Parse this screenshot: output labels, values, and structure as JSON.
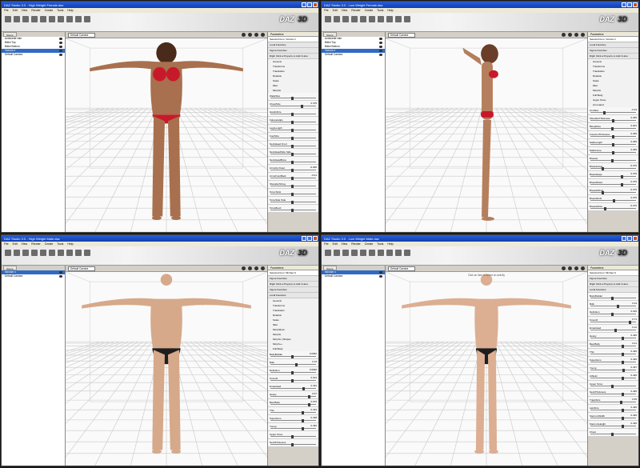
{
  "windows": [
    {
      "title": "DAZ Studio 3.0 - High Weight Female.daz",
      "menu": [
        "File",
        "Edit",
        "View",
        "Render",
        "Create",
        "Tools",
        "Help"
      ],
      "scene_tab": "Scene",
      "scene_items": [
        "Antoinette Hair",
        "Bikini Top",
        "Bikini Bottom",
        "Victoria 4",
        "Default Camera"
      ],
      "selected_scene_index": 3,
      "camera": "Default Camera",
      "params_tab": "Parameters",
      "selected_item_label": "Selected Item:",
      "selected_item": "Victoria 4",
      "groups_top": [
        "Local Favorites",
        "Figure Favorites",
        "Right Click a Property to Add it Here"
      ],
      "tree": [
        "General",
        "Transforms",
        "Translation",
        "Rotation",
        "Scale",
        "Misc",
        "Morphs"
      ],
      "sliders": [
        {
          "label": "WaistSize",
          "value": ""
        },
        {
          "label": "ChestSize",
          "value": "0.375"
        },
        {
          "label": "HandsSize",
          "value": ""
        },
        {
          "label": "FatnessHips",
          "value": ""
        },
        {
          "label": "LegsLength",
          "value": ""
        },
        {
          "label": "FootSize",
          "value": ""
        },
        {
          "label": "NeckHead Front",
          "value": ""
        },
        {
          "label": "NeckHeadSide Side",
          "value": ""
        },
        {
          "label": "NeckHeadBone",
          "value": ""
        },
        {
          "label": "ArmsUp Down",
          "value": "-0.000"
        },
        {
          "label": "ArmsFrontBack",
          "value": "-0.01"
        },
        {
          "label": "ShoulderShrug",
          "value": ""
        },
        {
          "label": "TorsoTwist",
          "value": ""
        },
        {
          "label": "TorsoSide Side",
          "value": ""
        },
        {
          "label": "TorsoBend",
          "value": ""
        }
      ]
    },
    {
      "title": "DAZ Studio 3.0 - Low Weight Female.daz",
      "menu": [
        "File",
        "Edit",
        "View",
        "Render",
        "Create",
        "Tools",
        "Help"
      ],
      "scene_tab": "Scene",
      "scene_items": [
        "Antoinette Hair",
        "Bikini Top",
        "Bikini Bottom",
        "Victoria 4",
        "Default Camera"
      ],
      "selected_scene_index": 3,
      "camera": "Default Camera",
      "params_tab": "Parameters",
      "selected_item_label": "Selected Item:",
      "selected_item": "Victoria 4",
      "groups_top": [
        "Local Favorites",
        "Figure Favorites",
        "Right Click a Property to Add it Here"
      ],
      "tree": [
        "General",
        "Transforms",
        "Translation",
        "Rotation",
        "Scale",
        "Misc",
        "Morphs",
        "Full Body",
        "Upper Torso",
        "Arm-Hand"
      ],
      "sliders": [
        {
          "label": "ArmSize",
          "value": "-0.33"
        },
        {
          "label": "ShoulderThickness",
          "value": "0.035"
        },
        {
          "label": "BiceptFlex",
          "value": "0.001"
        },
        {
          "label": "ForeArmThickness",
          "value": "0.035"
        },
        {
          "label": "NailsLength",
          "value": "0.035"
        },
        {
          "label": "NailsCurve",
          "value": "0.035"
        },
        {
          "label": "Breasts",
          "value": ""
        },
        {
          "label": "BreastLarge",
          "value": "-0.376"
        },
        {
          "label": "BreastsAge",
          "value": "0.379"
        },
        {
          "label": "BreastDown",
          "value": "0.370"
        },
        {
          "label": "BreastsShort",
          "value": "-0.376"
        },
        {
          "label": "BreastsFull",
          "value": "0.076"
        },
        {
          "label": "BreastsSize",
          "value": "-0.276"
        }
      ]
    },
    {
      "title": "DAZ Studio 3.0 - High Weight Male.daz",
      "menu": [
        "File",
        "Edit",
        "View",
        "Render",
        "Create",
        "Tools",
        "Help"
      ],
      "scene_tab": "Scene",
      "scene_items": [
        "Michael 4",
        "Default Camera"
      ],
      "selected_scene_index": 0,
      "camera": "Default Camera",
      "params_tab": "Parameters",
      "selected_item_label": "Selected Item:",
      "selected_item": "Michael 4",
      "groups_top": [
        "Figure Favorites",
        "Right Click a Property to Add it Here",
        "Figure Favorites",
        "Local Favorites"
      ],
      "tree": [
        "General",
        "Transforms",
        "Translation",
        "Rotation",
        "Scale",
        "Misc",
        "Morphdesc",
        "Morphs",
        "Morphs | Shapes",
        "Morph++",
        "Full Body"
      ],
      "sliders": [
        {
          "label": "BodyBuilder",
          "value": "0.0052"
        },
        {
          "label": "Bulk",
          "value": "0.16"
        },
        {
          "label": "Definition",
          "value": "0.0000"
        },
        {
          "label": "Smooth",
          "value": "0.014"
        },
        {
          "label": "Emaciated",
          "value": "0.434"
        },
        {
          "label": "Heavy",
          "value": "0.67"
        },
        {
          "label": "BeerBelly",
          "value": "0.676"
        },
        {
          "label": "Thin",
          "value": "0.424"
        },
        {
          "label": "SuperHero",
          "value": "0.428"
        },
        {
          "label": "Young",
          "value": "0.430"
        },
        {
          "label": "Upper Torso",
          "value": ""
        },
        {
          "label": "NeckThickness",
          "value": ""
        }
      ]
    },
    {
      "title": "DAZ Studio 3.0 - Low Weight Male.daz",
      "menu": [
        "File",
        "Edit",
        "View",
        "Render",
        "Create",
        "Tools",
        "Help"
      ],
      "scene_tab": "Scene",
      "scene_items": [
        "Michael 4",
        "Default Camera"
      ],
      "selected_scene_index": 0,
      "camera": "Default Camera",
      "activity_hint": "Click an item to select an activity",
      "activity_tab": "Activity Tabs",
      "params_tab": "Parameters",
      "selected_item_label": "Selected Item:",
      "selected_item": "Michael 4",
      "groups_top": [
        "Figure Favorites",
        "Right Click a Property to Add it Here",
        "Local Favorites"
      ],
      "tree": [],
      "sliders": [
        {
          "label": "BodyBuilder",
          "value": ""
        },
        {
          "label": "Bulk",
          "value": "0.24"
        },
        {
          "label": "Definition",
          "value": "0.016"
        },
        {
          "label": "Smooth",
          "value": "0.71"
        },
        {
          "label": "Emaciated",
          "value": "0.12"
        },
        {
          "label": "Heavy",
          "value": "0.426"
        },
        {
          "label": "BeerBelly",
          "value": "0.41"
        },
        {
          "label": "Thin",
          "value": "0.426"
        },
        {
          "label": "SuperHero",
          "value": "0.426"
        },
        {
          "label": "Young",
          "value": "0.437"
        },
        {
          "label": "Athletic",
          "value": "0.426"
        },
        {
          "label": "Upper Torso",
          "value": ""
        },
        {
          "label": "NeckThickness",
          "value": "0.426"
        },
        {
          "label": "TrapsSize",
          "value": "0.35"
        },
        {
          "label": "LatsSize",
          "value": "0.426"
        },
        {
          "label": "SternumWidth",
          "value": "0.426"
        },
        {
          "label": "SternumHeight",
          "value": "0.426"
        },
        {
          "label": "Chest",
          "value": ""
        }
      ]
    }
  ],
  "figures": [
    {
      "skin": "#a8704e",
      "outfit": "#c8192a",
      "type": "female-heavy",
      "pose": "front"
    },
    {
      "skin": "#b57e5c",
      "outfit": "#c8192a",
      "type": "female-thin",
      "pose": "side"
    },
    {
      "skin": "#d6a98a",
      "outfit": "#1e1e1e",
      "type": "male-heavy",
      "pose": "front"
    },
    {
      "skin": "#dcae92",
      "outfit": "#1e1e1e",
      "type": "male-thin",
      "pose": "front"
    }
  ]
}
